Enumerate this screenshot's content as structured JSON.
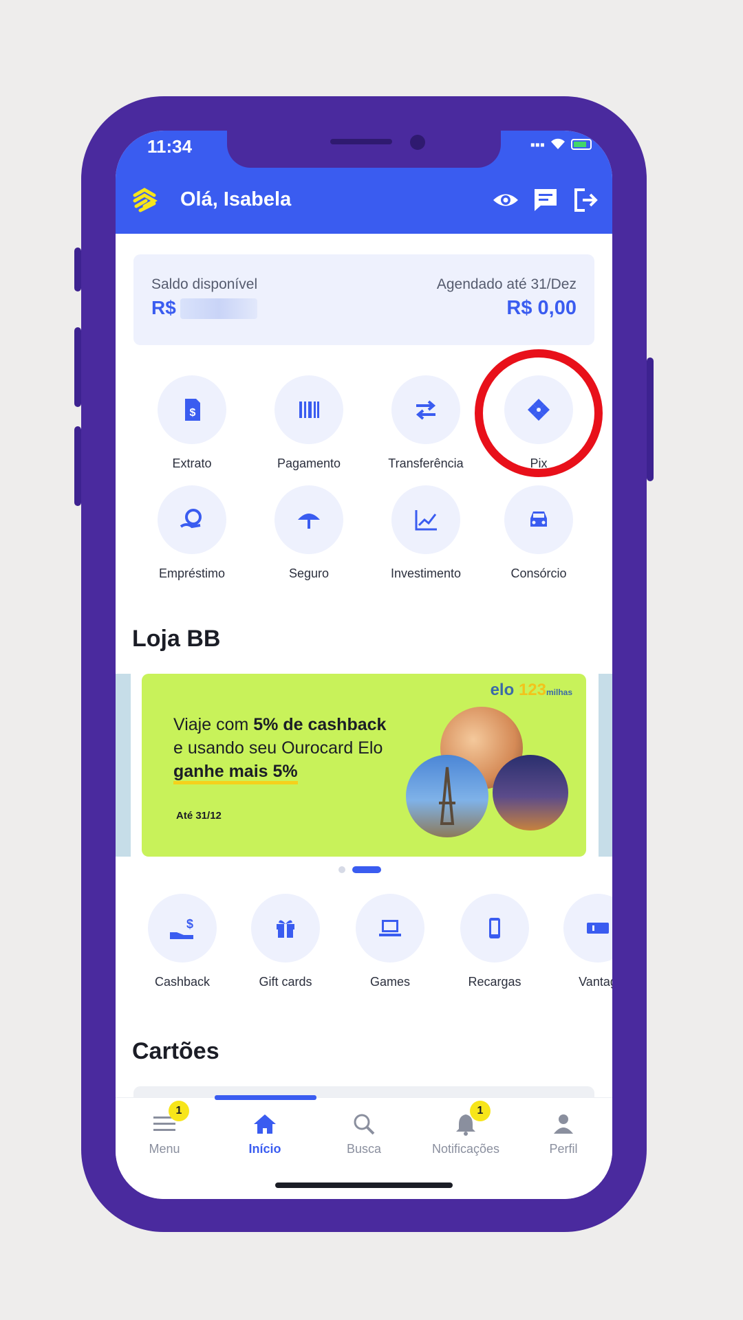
{
  "status_bar": {
    "time": "11:34"
  },
  "header": {
    "greeting": "Olá, Isabela"
  },
  "balance": {
    "available_label": "Saldo disponível",
    "available_currency": "R$",
    "scheduled_label": "Agendado até 31/Dez",
    "scheduled_value": "R$ 0,00"
  },
  "actions": [
    {
      "label": "Extrato",
      "icon": "document-icon"
    },
    {
      "label": "Pagamento",
      "icon": "barcode-icon"
    },
    {
      "label": "Transferência",
      "icon": "transfer-arrows-icon"
    },
    {
      "label": "Pix",
      "icon": "pix-icon"
    },
    {
      "label": "Empréstimo",
      "icon": "loan-icon"
    },
    {
      "label": "Seguro",
      "icon": "umbrella-icon"
    },
    {
      "label": "Investimento",
      "icon": "chart-icon"
    },
    {
      "label": "Consórcio",
      "icon": "car-icon"
    }
  ],
  "store": {
    "title": "Loja BB",
    "banner": {
      "line1_a": "Viaje com ",
      "line1_b": "5% de cashback",
      "line2": "e usando seu Ourocard Elo",
      "line3": "ganhe mais 5%",
      "date": "Até 31/12",
      "brand": "elo",
      "brand_numbers": "123",
      "brand_suffix": "milhas"
    },
    "items": [
      {
        "label": "Cashback",
        "icon": "cashback-icon"
      },
      {
        "label": "Gift cards",
        "icon": "gift-icon"
      },
      {
        "label": "Games",
        "icon": "laptop-icon"
      },
      {
        "label": "Recargas",
        "icon": "phone-icon"
      },
      {
        "label": "Vantag",
        "icon": "ticket-icon"
      }
    ]
  },
  "cards_section": {
    "title": "Cartões"
  },
  "tabbar": {
    "items": [
      {
        "label": "Menu",
        "icon": "menu-icon",
        "badge": "1"
      },
      {
        "label": "Início",
        "icon": "home-icon",
        "active": true
      },
      {
        "label": "Busca",
        "icon": "search-icon"
      },
      {
        "label": "Notificações",
        "icon": "bell-icon",
        "badge": "1"
      },
      {
        "label": "Perfil",
        "icon": "user-icon"
      }
    ]
  },
  "colors": {
    "primary": "#3a5cf0",
    "frame": "#4a2a9e",
    "banner": "#c8f25a",
    "highlight": "#e8101a",
    "badge": "#f7e51a"
  }
}
